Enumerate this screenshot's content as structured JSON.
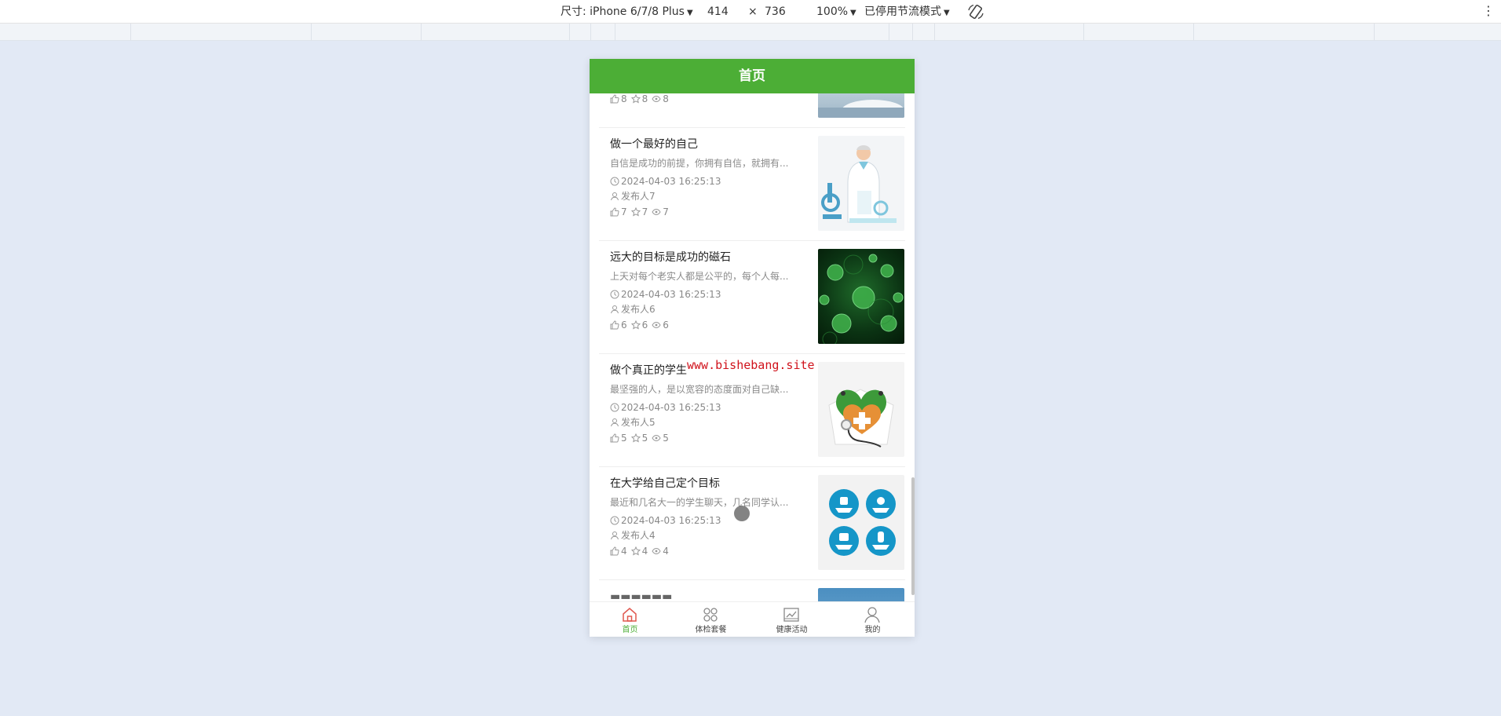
{
  "devtools": {
    "device_label": "尺寸: iPhone 6/7/8 Plus",
    "width": "414",
    "times": "×",
    "height": "736",
    "zoom": "100%",
    "throttle": "已停用节流模式",
    "rotate_icon": "rotate-icon",
    "more_icon": "kebab-menu-icon"
  },
  "app": {
    "title": "首页"
  },
  "articles": [
    {
      "title": "",
      "desc": "",
      "time": "",
      "author": "",
      "likes": "8",
      "favorites": "8",
      "views": "8",
      "image": "doctor-lab-photo"
    },
    {
      "title": "做一个最好的自己",
      "desc": "自信是成功的前提，你拥有自信，就拥有...",
      "time": "2024-04-03 16:25:13",
      "author": "发布人7",
      "likes": "7",
      "favorites": "7",
      "views": "7",
      "image": "doctor-microscope-illustration"
    },
    {
      "title": "远大的目标是成功的磁石",
      "desc": "上天对每个老实人都是公平的，每个人每...",
      "time": "2024-04-03 16:25:13",
      "author": "发布人6",
      "likes": "6",
      "favorites": "6",
      "views": "6",
      "image": "green-virus-image"
    },
    {
      "title": "做个真正的学生",
      "desc": "最坚强的人，是以宽容的态度面对自己缺...",
      "time": "2024-04-03 16:25:13",
      "author": "发布人5",
      "likes": "5",
      "favorites": "5",
      "views": "5",
      "image": "heart-stethoscope-image"
    },
    {
      "title": "在大学给自己定个目标",
      "desc": "最近和几名大一的学生聊天，几名同学认...",
      "time": "2024-04-03 16:25:13",
      "author": "发布人4",
      "likes": "4",
      "favorites": "4",
      "views": "4",
      "image": "blue-medical-icons-image"
    }
  ],
  "tabbar": [
    {
      "label": "首页",
      "icon": "home-icon",
      "active": true
    },
    {
      "label": "体检套餐",
      "icon": "grid-icon",
      "active": false
    },
    {
      "label": "健康活动",
      "icon": "chart-icon",
      "active": false
    },
    {
      "label": "我的",
      "icon": "user-icon",
      "active": false
    }
  ],
  "watermark": "www.bishebang.site",
  "colors": {
    "brand_green": "#4cae36",
    "page_bg": "#e2e9f5",
    "watermark_red": "#d0121b"
  }
}
